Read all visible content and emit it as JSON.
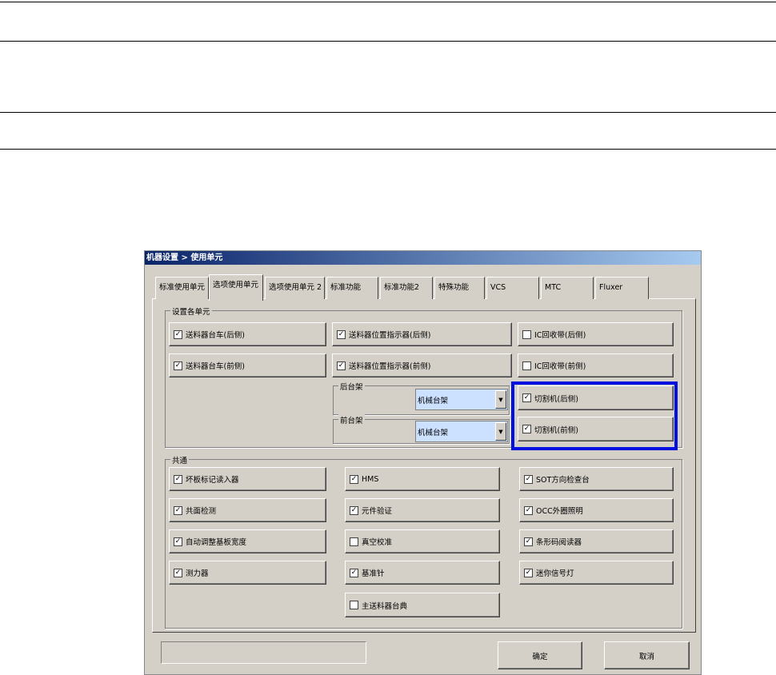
{
  "title": "机器设置 > 使用单元",
  "tabs": [
    "标准使用单元",
    "选项使用单元",
    "选项使用单元 2",
    "标准功能",
    "标准功能2",
    "特殊功能",
    "VCS",
    "MTC",
    "Fluxer"
  ],
  "group_units": {
    "label": "设置各单元",
    "items": [
      {
        "label": "送料器台车(后侧)",
        "checked": true
      },
      {
        "label": "送料器位置指示器(后侧)",
        "checked": true
      },
      {
        "label": "IC回收带(后侧)",
        "checked": false
      },
      {
        "label": "送料器台车(前侧)",
        "checked": true
      },
      {
        "label": "送料器位置指示器(前侧)",
        "checked": true
      },
      {
        "label": "IC回收带(前侧)",
        "checked": false
      },
      {
        "label": "切割机(后侧)",
        "checked": true
      },
      {
        "label": "切割机(前侧)",
        "checked": true
      }
    ],
    "rear_rack": {
      "label": "后台架",
      "value": "机械台架"
    },
    "front_rack": {
      "label": "前台架",
      "value": "机械台架"
    }
  },
  "group_common": {
    "label": "共通",
    "items": [
      {
        "label": "坏板标记读入器",
        "checked": true
      },
      {
        "label": "HMS",
        "checked": true
      },
      {
        "label": "SOT方向检查台",
        "checked": true
      },
      {
        "label": "共面检测",
        "checked": true
      },
      {
        "label": "元件验证",
        "checked": true
      },
      {
        "label": "OCC外圈照明",
        "checked": true
      },
      {
        "label": "自动调整基板宽度",
        "checked": true
      },
      {
        "label": "真空校准",
        "checked": false
      },
      {
        "label": "条形码阅读器",
        "checked": true
      },
      {
        "label": "测力器",
        "checked": true
      },
      {
        "label": "基准针",
        "checked": true
      },
      {
        "label": "迷你信号灯",
        "checked": true
      },
      {
        "label": "主送料器台典",
        "checked": false
      }
    ]
  },
  "buttons": {
    "ok": "确定",
    "cancel": "取消"
  },
  "highlight_color": "#0010e0"
}
